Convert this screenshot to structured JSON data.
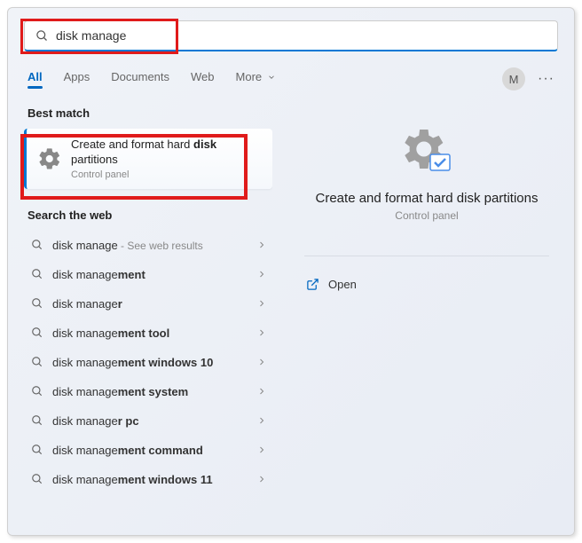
{
  "search": {
    "value": "disk manage"
  },
  "tabs": {
    "items": [
      {
        "label": "All",
        "active": true
      },
      {
        "label": "Apps"
      },
      {
        "label": "Documents"
      },
      {
        "label": "Web"
      },
      {
        "label": "More"
      }
    ],
    "avatar": "M"
  },
  "sections": {
    "best_match_title": "Best match",
    "web_title": "Search the web"
  },
  "best_match": {
    "title_prefix": "Create and format hard ",
    "title_bold": "disk",
    "title_line2": "partitions",
    "subtitle": "Control panel"
  },
  "web_results": [
    {
      "prefix": "disk manage",
      "bold": "",
      "suffix": " - See web results"
    },
    {
      "prefix": "disk manage",
      "bold": "ment",
      "suffix": ""
    },
    {
      "prefix": "disk manage",
      "bold": "r",
      "suffix": ""
    },
    {
      "prefix": "disk manage",
      "bold": "ment tool",
      "suffix": ""
    },
    {
      "prefix": "disk manage",
      "bold": "ment windows 10",
      "suffix": ""
    },
    {
      "prefix": "disk manage",
      "bold": "ment system",
      "suffix": ""
    },
    {
      "prefix": "disk manage",
      "bold": "r pc",
      "suffix": ""
    },
    {
      "prefix": "disk manage",
      "bold": "ment command",
      "suffix": ""
    },
    {
      "prefix": "disk manage",
      "bold": "ment windows 11",
      "suffix": ""
    }
  ],
  "preview": {
    "title": "Create and format hard disk partitions",
    "subtitle": "Control panel",
    "open_label": "Open"
  }
}
